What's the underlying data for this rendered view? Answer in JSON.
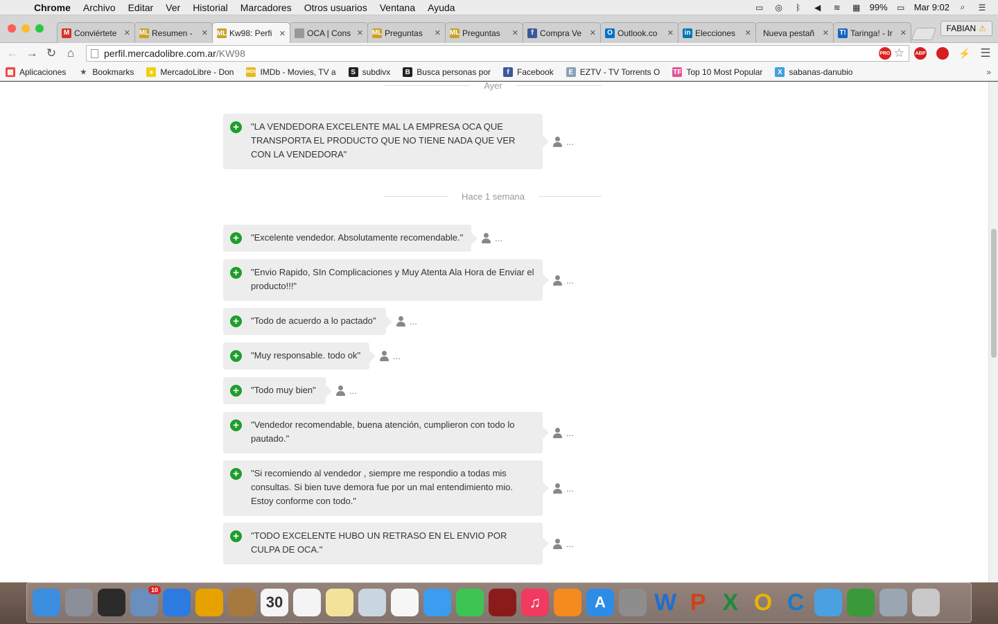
{
  "menubar": {
    "app_name": "Chrome",
    "items": [
      "Archivo",
      "Editar",
      "Ver",
      "Historial",
      "Marcadores",
      "Otros usuarios",
      "Ventana",
      "Ayuda"
    ],
    "battery": "99%",
    "clock": "Mar 9:02"
  },
  "tabs": [
    {
      "title": "Conviértete",
      "favicon": "gmail-icon",
      "color": "#d93025",
      "glyph": "M"
    },
    {
      "title": "Resumen -",
      "favicon": "mercadolibre-icon",
      "color": "#c9a227",
      "glyph": "ML"
    },
    {
      "title": "Kw98: Perfi",
      "favicon": "mercadolibre-icon",
      "color": "#c9a227",
      "glyph": "ML"
    },
    {
      "title": "OCA | Cons",
      "favicon": "page-icon",
      "color": "#999999",
      "glyph": ""
    },
    {
      "title": "Preguntas",
      "favicon": "mercadolibre-icon",
      "color": "#c9a227",
      "glyph": "ML"
    },
    {
      "title": "Preguntas",
      "favicon": "mercadolibre-icon",
      "color": "#c9a227",
      "glyph": "ML"
    },
    {
      "title": "Compra Ve",
      "favicon": "facebook-icon",
      "color": "#3b5998",
      "glyph": "f"
    },
    {
      "title": "Outlook.co",
      "favicon": "outlook-icon",
      "color": "#0072c6",
      "glyph": "O"
    },
    {
      "title": "Elecciones",
      "favicon": "linkedin-icon",
      "color": "#0077b5",
      "glyph": "in"
    },
    {
      "title": "Nueva pestañ",
      "favicon": "",
      "color": "",
      "glyph": ""
    },
    {
      "title": "Taringa! - Ir",
      "favicon": "taringa-icon",
      "color": "#1565c0",
      "glyph": "T!"
    }
  ],
  "profile": "FABIAN",
  "address": {
    "host": "perfil.mercadolibre.com.ar",
    "path": "/KW98"
  },
  "extensions": [
    {
      "name": "adblock-plus-icon",
      "glyph": "ABP",
      "color": "#d51f1f"
    },
    {
      "name": "adblock-icon",
      "glyph": "",
      "color": "#d51f1f"
    },
    {
      "name": "lightning-icon",
      "glyph": "⚡",
      "color": "#444444"
    }
  ],
  "bookmarks": [
    {
      "label": "Aplicaciones",
      "icon": "apps-icon"
    },
    {
      "label": "Bookmarks",
      "icon": "star-icon"
    },
    {
      "label": "MercadoLibre - Don",
      "icon": "mercadolibre-icon"
    },
    {
      "label": "IMDb - Movies, TV a",
      "icon": "imdb-icon"
    },
    {
      "label": "subdivx",
      "icon": "subdivx-icon"
    },
    {
      "label": "Busca personas por",
      "icon": "b-icon"
    },
    {
      "label": "Facebook",
      "icon": "facebook-icon"
    },
    {
      "label": "EZTV - TV Torrents O",
      "icon": "eztv-icon"
    },
    {
      "label": "Top 10 Most Popular",
      "icon": "tf-icon"
    },
    {
      "label": "sabanas-danubio",
      "icon": "x-icon"
    }
  ],
  "bookmarks_overflow": "»",
  "page": {
    "groups": [
      {
        "label": "Ayer"
      },
      {
        "label": "Hace 1 semana"
      }
    ],
    "feedback": [
      {
        "text": "\"LA VENDEDORA EXCELENTE MAL LA EMPRESA OCA QUE TRANSPORTA EL PRODUCTO QUE NO TIENE NADA QUE VER CON LA VENDEDORA\"",
        "author": "...",
        "rating": "positive"
      },
      {
        "text": "\"Excelente vendedor. Absolutamente recomendable.\"",
        "author": "...",
        "rating": "positive"
      },
      {
        "text": "\"Envio Rapido, SIn Complicaciones y Muy Atenta Ala Hora de Enviar el producto!!!\"",
        "author": "...",
        "rating": "positive"
      },
      {
        "text": "\"Todo de acuerdo a lo pactado\"",
        "author": "...",
        "rating": "positive"
      },
      {
        "text": "\"Muy responsable. todo ok\"",
        "author": "...",
        "rating": "positive"
      },
      {
        "text": "\"Todo muy bien\"",
        "author": "...",
        "rating": "positive"
      },
      {
        "text": "\"Vendedor recomendable, buena atención, cumplieron con todo lo pautado.\"",
        "author": "...",
        "rating": "positive"
      },
      {
        "text": "\"Si recomiendo al vendedor , siempre me respondio a todas mis consultas. Si bien tuve demora fue por un mal entendimiento mio. Estoy conforme con todo.\"",
        "author": "...",
        "rating": "positive"
      },
      {
        "text": "\"TODO EXCELENTE HUBO UN RETRASO EN EL ENVIO POR CULPA DE OCA.\"",
        "author": "...",
        "rating": "positive"
      }
    ]
  },
  "dock": [
    {
      "name": "finder-icon",
      "color": "#3b8de0",
      "glyph": ""
    },
    {
      "name": "launchpad-icon",
      "color": "#8a8f99",
      "glyph": ""
    },
    {
      "name": "mission-control-icon",
      "color": "#2b2b2b",
      "glyph": ""
    },
    {
      "name": "mail-icon",
      "color": "#6a8fbf",
      "glyph": "",
      "badge": "10"
    },
    {
      "name": "safari-icon",
      "color": "#2d7be0",
      "glyph": ""
    },
    {
      "name": "chrome-icon",
      "color": "#e8a200",
      "glyph": ""
    },
    {
      "name": "contacts-icon",
      "color": "#a8793e",
      "glyph": ""
    },
    {
      "name": "calendar-icon",
      "color": "#f4f4f4",
      "glyph": "30"
    },
    {
      "name": "reminders-icon",
      "color": "#f4f4f4",
      "glyph": ""
    },
    {
      "name": "notes-icon",
      "color": "#f3e39a",
      "glyph": ""
    },
    {
      "name": "preview-icon",
      "color": "#c9d6e0",
      "glyph": ""
    },
    {
      "name": "photos-icon",
      "color": "#f6f6f6",
      "glyph": ""
    },
    {
      "name": "messages-icon",
      "color": "#3b9cf0",
      "glyph": ""
    },
    {
      "name": "facetime-icon",
      "color": "#3ec453",
      "glyph": ""
    },
    {
      "name": "photo-booth-icon",
      "color": "#8a1b1b",
      "glyph": ""
    },
    {
      "name": "itunes-icon",
      "color": "#f03a5f",
      "glyph": "♫"
    },
    {
      "name": "ibooks-icon",
      "color": "#f58a1f",
      "glyph": ""
    },
    {
      "name": "app-store-icon",
      "color": "#2d8ce8",
      "glyph": "A"
    },
    {
      "name": "system-preferences-icon",
      "color": "#8d8d8d",
      "glyph": ""
    },
    {
      "name": "word-icon",
      "color": "#1f6fd0",
      "glyph": "W"
    },
    {
      "name": "powerpoint-icon",
      "color": "#d04218",
      "glyph": "P"
    },
    {
      "name": "excel-icon",
      "color": "#1e8a3c",
      "glyph": "X"
    },
    {
      "name": "outlook-icon",
      "color": "#e8b400",
      "glyph": "O"
    },
    {
      "name": "communicator-icon",
      "color": "#1b79c8",
      "glyph": "C"
    },
    {
      "name": "messenger-icon",
      "color": "#4aa0e0",
      "glyph": ""
    },
    {
      "name": "network-icon",
      "color": "#3a9a3a",
      "glyph": ""
    },
    {
      "name": "utility-icon",
      "color": "#9aa7b3",
      "glyph": ""
    },
    {
      "name": "trash-icon",
      "color": "#c9c9c9",
      "glyph": ""
    }
  ]
}
